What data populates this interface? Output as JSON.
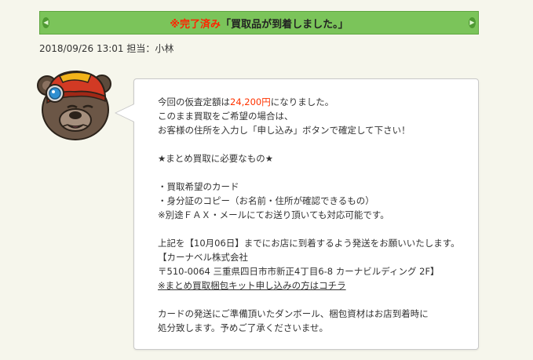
{
  "status": {
    "prefix": "※完了済み",
    "message": "「買取品が到着しました。」"
  },
  "meta": {
    "timestamp": "2018/09/26 13:01",
    "staff": "担当：小林"
  },
  "message": {
    "line1_a": "今回の仮査定額は",
    "line1_amount": "24,200円",
    "line1_b": "になりました。",
    "line2": "このまま買取をご希望の場合は、",
    "line3": "お客様の住所を入力し「申し込み」ボタンで確定して下さい！",
    "heading": "★まとめ買取に必要なもの★",
    "item1": "・買取希望のカード",
    "item2": "・身分証のコピー（お名前・住所が確認できるもの）",
    "item3": "※別途ＦＡＸ・メールにてお送り頂いても対応可能です。",
    "deadline": "上記を【10月06日】までにお店に到着するよう発送をお願いいたします。",
    "company": "【カーナベル株式会社",
    "address": "〒510-0064 三重県四日市市新正4丁目6-8 カーナビルディング 2F】",
    "kit_link": "※まとめ買取梱包キット申し込みの方はコチラ",
    "closing1": "カードの発送にご準備頂いたダンボール、梱包資材はお店到着時に",
    "closing2": "処分致します。予めご了承くださいませ。"
  },
  "colors": {
    "status_bar": "#7bc45a",
    "highlight": "#ff3300"
  },
  "icons": {
    "avatar": "bear-mascot-with-helmet"
  }
}
